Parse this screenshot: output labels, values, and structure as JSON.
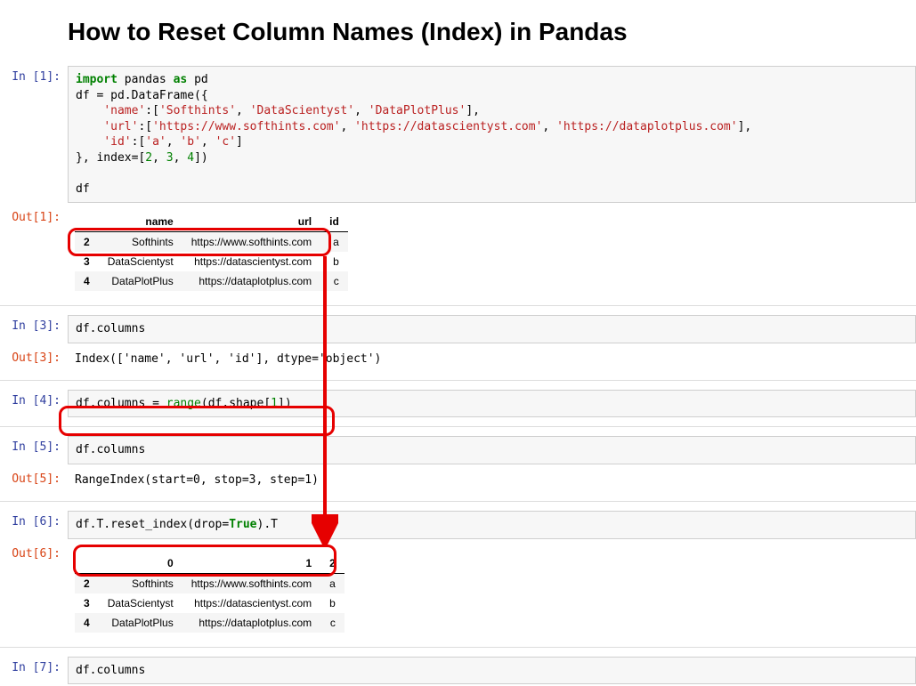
{
  "title": "How to Reset Column Names (Index) in Pandas",
  "prompts": {
    "in1": "In [1]:",
    "out1": "Out[1]:",
    "in3": "In [3]:",
    "out3": "Out[3]:",
    "in4": "In [4]:",
    "in5": "In [5]:",
    "out5": "Out[5]:",
    "in6": "In [6]:",
    "out6": "Out[6]:",
    "in7": "In [7]:"
  },
  "code1": {
    "l1a": "import",
    "l1b": " pandas ",
    "l1c": "as",
    "l1d": " pd",
    "l2": "df = pd.DataFrame({",
    "l3a": "    ",
    "l3b": "'name'",
    "l3c": ":[",
    "l3d": "'Softhints'",
    "l3e": ", ",
    "l3f": "'DataScientyst'",
    "l3g": ", ",
    "l3h": "'DataPlotPlus'",
    "l3i": "],",
    "l4a": "    ",
    "l4b": "'url'",
    "l4c": ":[",
    "l4d": "'https://www.softhints.com'",
    "l4e": ", ",
    "l4f": "'https://datascientyst.com'",
    "l4g": ", ",
    "l4h": "'https://dataplotplus.com'",
    "l4i": "],",
    "l5a": "    ",
    "l5b": "'id'",
    "l5c": ":[",
    "l5d": "'a'",
    "l5e": ", ",
    "l5f": "'b'",
    "l5g": ", ",
    "l5h": "'c'",
    "l5i": "]",
    "l6a": "}, index=[",
    "l6b": "2",
    "l6c": ", ",
    "l6d": "3",
    "l6e": ", ",
    "l6f": "4",
    "l6g": "])",
    "l7": "",
    "l8": "df"
  },
  "table1": {
    "headers": [
      "",
      "name",
      "url",
      "id"
    ],
    "rows": [
      {
        "idx": "2",
        "name": "Softhints",
        "url": "https://www.softhints.com",
        "id": "a"
      },
      {
        "idx": "3",
        "name": "DataScientyst",
        "url": "https://datascientyst.com",
        "id": "b"
      },
      {
        "idx": "4",
        "name": "DataPlotPlus",
        "url": "https://dataplotplus.com",
        "id": "c"
      }
    ]
  },
  "code3": "df.columns",
  "out3": "Index(['name', 'url', 'id'], dtype='object')",
  "code4": {
    "a": "df.columns = ",
    "b": "range",
    "c": "(df.shape[",
    "d": "1",
    "e": "])"
  },
  "code5": "df.columns",
  "out5": "RangeIndex(start=0, stop=3, step=1)",
  "code6": {
    "a": "df.T.reset_index(drop=",
    "b": "True",
    "c": ").T"
  },
  "table6": {
    "headers": [
      "",
      "0",
      "1",
      "2"
    ],
    "rows": [
      {
        "idx": "2",
        "c0": "Softhints",
        "c1": "https://www.softhints.com",
        "c2": "a"
      },
      {
        "idx": "3",
        "c0": "DataScientyst",
        "c1": "https://datascientyst.com",
        "c2": "b"
      },
      {
        "idx": "4",
        "c0": "DataPlotPlus",
        "c1": "https://dataplotplus.com",
        "c2": "c"
      }
    ]
  },
  "code7": "df.columns"
}
